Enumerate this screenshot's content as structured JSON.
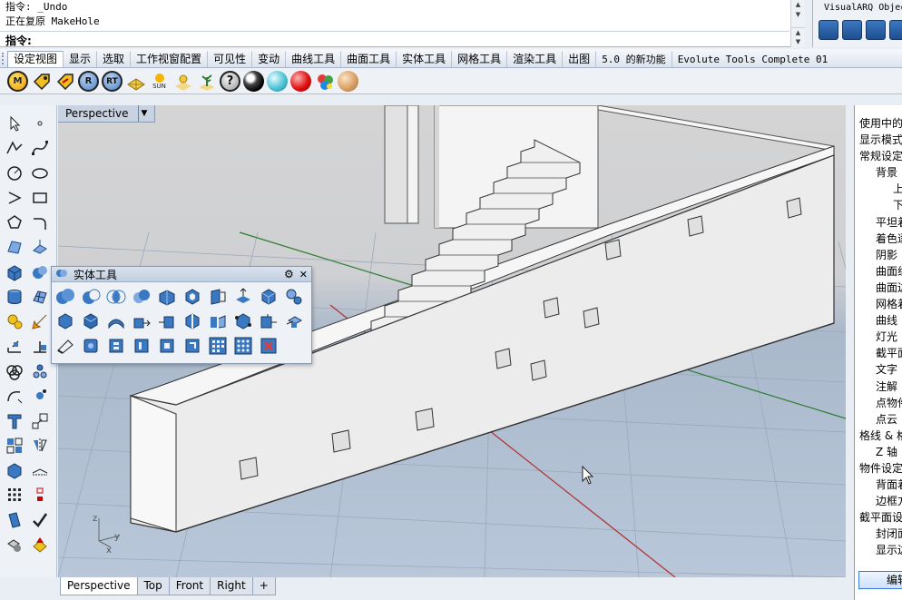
{
  "command_history": {
    "lines": [
      "指令: _Undo",
      "正在复原 MakeHole"
    ],
    "prompt_label": "指令:",
    "prompt_value": ""
  },
  "visualarq": {
    "title": "VisualARQ Objec"
  },
  "main_tabs": [
    {
      "label": "设定视图",
      "active": true
    },
    {
      "label": "显示"
    },
    {
      "label": "选取"
    },
    {
      "label": "工作视窗配置"
    },
    {
      "label": "可见性"
    },
    {
      "label": "变动"
    },
    {
      "label": "曲线工具"
    },
    {
      "label": "曲面工具"
    },
    {
      "label": "实体工具"
    },
    {
      "label": "网格工具"
    },
    {
      "label": "渲染工具"
    },
    {
      "label": "出图"
    },
    {
      "label": "5.0 的新功能"
    },
    {
      "label": "Evolute Tools Complete 01"
    }
  ],
  "toolbar": {
    "m_label": "M",
    "r_label": "R",
    "rt_label": "RT",
    "sun_label": "SUN",
    "help_label": "?"
  },
  "viewport": {
    "active_name": "Perspective",
    "axis_x": "x",
    "axis_y": "y",
    "axis_z": "z"
  },
  "palette": {
    "title": "实体工具"
  },
  "right_panel": {
    "rows": [
      {
        "text": "使用中的",
        "indent": 0
      },
      {
        "text": "显示模式",
        "indent": 0
      },
      {
        "text": "常规设定",
        "indent": 0
      },
      {
        "text": "背景",
        "indent": 1
      },
      {
        "text": "上",
        "indent": 3
      },
      {
        "text": "下",
        "indent": 3
      },
      {
        "text": "平坦着",
        "indent": 2
      },
      {
        "text": "着色逐",
        "indent": 2
      },
      {
        "text": "阴影",
        "indent": 2
      },
      {
        "text": "曲面组",
        "indent": 2
      },
      {
        "text": "曲面边",
        "indent": 2
      },
      {
        "text": "网格着",
        "indent": 2
      },
      {
        "text": "曲线",
        "indent": 2
      },
      {
        "text": "灯光",
        "indent": 2
      },
      {
        "text": "截平面",
        "indent": 2
      },
      {
        "text": "文字",
        "indent": 2
      },
      {
        "text": "注解",
        "indent": 2
      },
      {
        "text": "点物件",
        "indent": 2
      },
      {
        "text": "点云",
        "indent": 2
      },
      {
        "text": "格线 & 格",
        "indent": 0
      },
      {
        "text": "Z 轴",
        "indent": 2
      },
      {
        "text": "物件设定",
        "indent": 0
      },
      {
        "text": "背面着",
        "indent": 1
      },
      {
        "text": "边框方",
        "indent": 1
      },
      {
        "text": "截平面设",
        "indent": 0
      },
      {
        "text": "封闭面",
        "indent": 1
      },
      {
        "text": "显示边",
        "indent": 1
      }
    ],
    "button_label": "编辑"
  },
  "bottom_tabs": [
    {
      "label": "Perspective",
      "active": true
    },
    {
      "label": "Top"
    },
    {
      "label": "Front"
    },
    {
      "label": "Right"
    }
  ],
  "bottom_add_label": "+"
}
